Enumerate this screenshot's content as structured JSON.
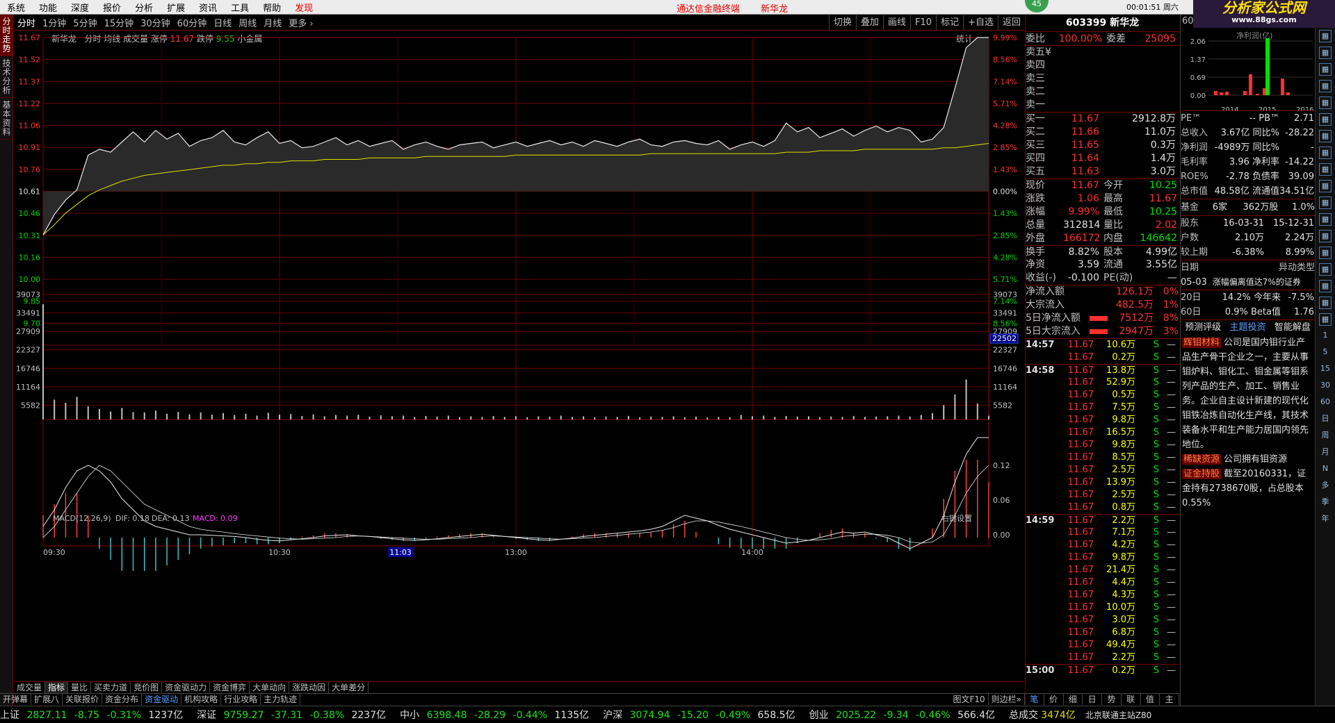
{
  "menu": {
    "items": [
      "系统",
      "功能",
      "深度",
      "报价",
      "分析",
      "扩展",
      "资讯",
      "工具",
      "帮助",
      "发现"
    ],
    "center": [
      "通达信金融终端",
      "新华龙"
    ],
    "time": "00:01:51 周六",
    "badge": "45"
  },
  "logo": {
    "title": "分析家公式网",
    "url": "www.88gs.com"
  },
  "left_tabs": [
    "分时走势",
    "技术分析",
    "基本资料"
  ],
  "periods": [
    "分时",
    "1分钟",
    "5分钟",
    "15分钟",
    "30分钟",
    "60分钟",
    "日线",
    "周线",
    "月线",
    "更多 ›"
  ],
  "chart_tools": [
    "切换",
    "叠加",
    "画线",
    "F10",
    "标记",
    "+自选",
    "返回"
  ],
  "chart_header": {
    "name": "新华龙",
    "items": "分时 均线 成交量 涨停",
    "zt": "11.67",
    "dt_label": "跌停",
    "dt": "9.55",
    "block": "小金属",
    "stat": "统计"
  },
  "price_axis": {
    "left": [
      "11.67",
      "11.52",
      "11.37",
      "11.22",
      "11.06",
      "10.91",
      "10.76",
      "10.61",
      "10.46",
      "10.31",
      "10.16",
      "10.00",
      "9.85",
      "9.70"
    ],
    "right": [
      "9.99%",
      "8.56%",
      "7.14%",
      "5.71%",
      "4.28%",
      "2.85%",
      "1.43%",
      "0.00%",
      "1.43%",
      "2.85%",
      "4.28%",
      "5.71%",
      "7.14%",
      "8.56%"
    ]
  },
  "vol_axis": [
    "39073",
    "33491",
    "27909",
    "22327",
    "16746",
    "11164",
    "5582"
  ],
  "vol_cursor": "22502",
  "macd": {
    "title": "MACD(12,26,9)",
    "dif": "DIF: 0.18",
    "dea": "DEA: 0.13",
    "macd": "MACD: 0.09",
    "setting": "右键设置",
    "axis": [
      "0.12",
      "0.06",
      "0.00"
    ]
  },
  "time_axis": [
    "09:30",
    "10:30",
    "11:03",
    "13:00",
    "14:00"
  ],
  "bottom_tabs": [
    "成交量",
    "指标",
    "量比",
    "买卖力道",
    "竞价图",
    "资金驱动力",
    "资金博弈",
    "大单动向",
    "涨跌动因",
    "大单差分"
  ],
  "bottom_tabs2": [
    "开弹幕",
    "扩展八",
    "关联报价",
    "资金分布",
    "资金驱动",
    "机构攻略",
    "行业攻略",
    "主力轨迹"
  ],
  "bottom_tabs2_right": [
    "图文F10",
    "则边栏»"
  ],
  "quote": {
    "title": "603399 新华龙",
    "wb": [
      "委比",
      "100.00%",
      "委差",
      "25095"
    ],
    "sells": [
      "卖五",
      "卖四",
      "卖三",
      "卖二",
      "卖一"
    ],
    "sell_mark": "¥",
    "buys": [
      [
        "买一",
        "11.67",
        "2912.8万"
      ],
      [
        "买二",
        "11.66",
        "11.0万"
      ],
      [
        "买三",
        "11.65",
        "0.3万"
      ],
      [
        "买四",
        "11.64",
        "1.4万"
      ],
      [
        "买五",
        "11.63",
        "3.0万"
      ]
    ],
    "info": [
      [
        "现价",
        "11.67",
        "今开",
        "10.25"
      ],
      [
        "涨跌",
        "1.06",
        "最高",
        "11.67"
      ],
      [
        "涨幅",
        "9.99%",
        "最低",
        "10.25"
      ],
      [
        "总量",
        "312814",
        "量比",
        "2.02"
      ],
      [
        "外盘",
        "166172",
        "内盘",
        "146642"
      ],
      [
        "换手",
        "8.82%",
        "股本",
        "4.99亿"
      ],
      [
        "净资",
        "3.59",
        "流通",
        "3.55亿"
      ],
      [
        "收益(-)",
        "-0.100",
        "PE(动)",
        "—"
      ]
    ],
    "flows": [
      [
        "净流入额",
        "126.1万",
        "0%"
      ],
      [
        "大宗流入",
        "482.5万",
        "1%"
      ],
      [
        "5日净流入额",
        "7512万",
        "8%"
      ],
      [
        "5日大宗流入",
        "2947万",
        "3%"
      ]
    ]
  },
  "ticks": [
    [
      "14:57",
      "11.67",
      "10.6万",
      "S",
      "—"
    ],
    [
      "",
      "11.67",
      "0.2万",
      "S",
      "—"
    ],
    [
      "14:58",
      "11.67",
      "13.8万",
      "S",
      "—"
    ],
    [
      "",
      "11.67",
      "52.9万",
      "S",
      "—"
    ],
    [
      "",
      "11.67",
      "0.5万",
      "S",
      "—"
    ],
    [
      "",
      "11.67",
      "7.5万",
      "S",
      "—"
    ],
    [
      "",
      "11.67",
      "9.8万",
      "S",
      "—"
    ],
    [
      "",
      "11.67",
      "16.5万",
      "S",
      "—"
    ],
    [
      "",
      "11.67",
      "9.8万",
      "S",
      "—"
    ],
    [
      "",
      "11.67",
      "8.5万",
      "S",
      "—"
    ],
    [
      "",
      "11.67",
      "2.5万",
      "S",
      "—"
    ],
    [
      "",
      "11.67",
      "13.9万",
      "S",
      "—"
    ],
    [
      "",
      "11.67",
      "2.5万",
      "S",
      "—"
    ],
    [
      "",
      "11.67",
      "0.8万",
      "S",
      "—"
    ],
    [
      "14:59",
      "11.67",
      "2.2万",
      "S",
      "—"
    ],
    [
      "",
      "11.67",
      "7.1万",
      "S",
      "—"
    ],
    [
      "",
      "11.67",
      "4.2万",
      "S",
      "—"
    ],
    [
      "",
      "11.67",
      "9.8万",
      "S",
      "—"
    ],
    [
      "",
      "11.67",
      "21.4万",
      "S",
      "—"
    ],
    [
      "",
      "11.67",
      "4.4万",
      "S",
      "—"
    ],
    [
      "",
      "11.67",
      "4.3万",
      "S",
      "—"
    ],
    [
      "",
      "11.67",
      "10.0万",
      "S",
      "—"
    ],
    [
      "",
      "11.67",
      "3.0万",
      "S",
      "—"
    ],
    [
      "",
      "11.67",
      "6.8万",
      "S",
      "—"
    ],
    [
      "",
      "11.67",
      "49.4万",
      "S",
      "—"
    ],
    [
      "",
      "11.67",
      "2.2万",
      "S",
      "—"
    ],
    [
      "15:00",
      "11.67",
      "0.2万",
      "S",
      "—"
    ]
  ],
  "bottom_right": [
    "笔",
    "价",
    "细",
    "日",
    "势",
    "联",
    "值",
    "主"
  ],
  "fundamentals": {
    "head": "60",
    "bar_axis": [
      "2.06",
      "1.37",
      "0.69",
      "0.00"
    ],
    "bar_years": [
      "2014",
      "2015",
      "2016"
    ],
    "bar_caption": "净利润(亿)",
    "rows": [
      [
        "PE™",
        "-- PB™",
        "2.71"
      ],
      [
        "总收入",
        "3.67亿 同比%",
        "-28.22"
      ],
      [
        "净利润",
        "-4989万 同比%",
        "-"
      ],
      [
        "毛利率",
        "3.96 净利率",
        "-14.22"
      ],
      [
        "ROE%",
        "-2.78 负债率",
        "39.09"
      ],
      [
        "总市值",
        "48.58亿 流通值",
        "34.51亿"
      ]
    ],
    "fund": [
      "基金",
      "6家",
      "362万股",
      "1.0%"
    ],
    "holders": [
      [
        "股东",
        "16-03-31",
        "15-12-31"
      ],
      [
        "户数",
        "2.10万",
        "2.24万"
      ],
      [
        "较上期",
        "-6.38%",
        "8.99%"
      ]
    ],
    "event_head": [
      "日期",
      "异动类型"
    ],
    "event": [
      "05-03",
      "涨幅偏离值达7%的证券"
    ],
    "perf": [
      [
        "20日",
        "14.2% 今年来",
        "-7.5%"
      ],
      [
        "60日",
        "0.9% Beta值",
        "1.76"
      ]
    ],
    "tabs": [
      "预测评级",
      "主题投资",
      "智能解盘"
    ],
    "themes": [
      {
        "tag": "辉钼材料",
        "text": "公司是国内钼行业产品生产骨干企业之一，主要从事钼炉料、钼化工、钼金属等钼系列产品的生产、加工、销售业务。企业自主设计新建的现代化钼铁冶炼自动化生产线，其技术装备水平和生产能力居国内领先地位。"
      },
      {
        "tag": "稀缺资源",
        "text": "公司拥有钼资源"
      },
      {
        "tag": "证金持股",
        "text": "截至20160331，证金持有2738670股，占总股本0.55%"
      }
    ]
  },
  "icon_bar": [
    "1",
    "5",
    "15",
    "30",
    "60",
    "日",
    "周",
    "月",
    "N",
    "多",
    "季",
    "年"
  ],
  "status": [
    {
      "name": "上证",
      "price": "2827.11",
      "chg": "-8.75",
      "pct": "-0.31%",
      "amt": "1237亿"
    },
    {
      "name": "深证",
      "price": "9759.27",
      "chg": "-37.31",
      "pct": "-0.38%",
      "amt": "2237亿"
    },
    {
      "name": "中小",
      "price": "6398.48",
      "chg": "-28.29",
      "pct": "-0.44%",
      "amt": "1135亿"
    },
    {
      "name": "沪深",
      "price": "3074.94",
      "chg": "-15.20",
      "pct": "-0.49%",
      "amt": "658.5亿"
    },
    {
      "name": "创业",
      "price": "2025.22",
      "chg": "-9.34",
      "pct": "-0.46%",
      "amt": "566.4亿"
    }
  ],
  "status_total": {
    "label": "总成交",
    "value": "3474亿",
    "server": "北京联通主站Z80"
  },
  "chart_data": {
    "type": "line",
    "title": "新华龙 分时",
    "prev_close": 10.61,
    "ylim": [
      9.55,
      11.67
    ],
    "price_series": [
      10.31,
      10.45,
      10.55,
      10.62,
      10.86,
      10.9,
      10.88,
      10.95,
      11.02,
      10.95,
      11.03,
      10.97,
      11.01,
      10.92,
      10.96,
      10.98,
      11.03,
      10.95,
      10.93,
      10.98,
      11.02,
      10.94,
      10.96,
      10.91,
      10.92,
      10.95,
      10.98,
      10.93,
      10.96,
      10.92,
      10.94,
      10.96,
      10.9,
      10.93,
      10.95,
      10.92,
      10.9,
      10.93,
      10.94,
      10.95,
      10.91,
      10.93,
      10.95,
      10.92,
      10.94,
      10.96,
      10.93,
      10.95,
      10.92,
      10.96,
      10.94,
      10.92,
      10.95,
      10.97,
      10.93,
      10.92,
      10.95,
      10.96,
      10.94,
      10.93,
      10.96,
      10.9,
      10.93,
      10.95,
      10.92,
      10.96,
      11.08,
      11.02,
      11.05,
      10.98,
      11.01,
      11.04,
      10.99,
      11.03,
      11.06,
      11.02,
      11.05,
      11.03,
      10.95,
      10.97,
      11.05,
      11.32,
      11.6,
      11.67,
      11.67
    ],
    "avg_series": [
      10.31,
      10.38,
      10.46,
      10.52,
      10.58,
      10.62,
      10.65,
      10.68,
      10.7,
      10.72,
      10.73,
      10.74,
      10.75,
      10.76,
      10.77,
      10.78,
      10.79,
      10.79,
      10.8,
      10.8,
      10.81,
      10.81,
      10.82,
      10.82,
      10.82,
      10.83,
      10.83,
      10.83,
      10.83,
      10.84,
      10.84,
      10.84,
      10.84,
      10.84,
      10.85,
      10.85,
      10.85,
      10.85,
      10.85,
      10.85,
      10.85,
      10.85,
      10.86,
      10.86,
      10.86,
      10.86,
      10.86,
      10.86,
      10.86,
      10.86,
      10.86,
      10.86,
      10.86,
      10.86,
      10.87,
      10.87,
      10.87,
      10.87,
      10.87,
      10.87,
      10.87,
      10.87,
      10.87,
      10.87,
      10.87,
      10.87,
      10.88,
      10.88,
      10.88,
      10.89,
      10.89,
      10.89,
      10.89,
      10.9,
      10.9,
      10.9,
      10.9,
      10.9,
      10.9,
      10.9,
      10.91,
      10.91,
      10.92,
      10.93,
      10.94
    ],
    "volume_series": [
      36000,
      6200,
      5200,
      7100,
      4100,
      3300,
      2500,
      3600,
      2300,
      2200,
      2800,
      1800,
      2400,
      1600,
      2200,
      1500,
      2000,
      1400,
      1800,
      1200,
      2100,
      1500,
      1700,
      1100,
      1600,
      1000,
      1400,
      1200,
      1500,
      900,
      1300,
      1000,
      1200,
      800,
      1100,
      900,
      1200,
      700,
      1000,
      800,
      1100,
      800,
      1000,
      700,
      1000,
      900,
      1200,
      800,
      1000,
      700,
      900,
      800,
      1100,
      700,
      900,
      800,
      1000,
      700,
      900,
      600,
      800,
      700,
      1400,
      1000,
      1200,
      800,
      1100,
      900,
      1000,
      700,
      900,
      800,
      1100,
      800,
      900,
      1000,
      1200,
      900,
      1400,
      2000,
      4500,
      7800,
      12500,
      5000,
      1200
    ],
    "macd_dif": [
      0.02,
      0.05,
      0.09,
      0.12,
      0.13,
      0.12,
      0.1,
      0.07,
      0.05,
      0.03,
      0.02,
      0.015,
      0.01,
      0.005,
      0.005,
      0.004,
      0.003,
      0.002,
      0.0,
      -0.003,
      -0.005,
      -0.006,
      -0.004,
      -0.002,
      0.0,
      0.003,
      0.004,
      0.005,
      0.003,
      0.002,
      0.0,
      -0.002,
      -0.004,
      -0.005,
      -0.004,
      -0.002,
      0.0,
      0.002,
      0.004,
      0.006,
      0.004,
      0.002,
      0.0,
      -0.002,
      -0.004,
      -0.005,
      -0.003,
      -0.001,
      0.002,
      0.004,
      0.006,
      0.008,
      0.01,
      0.012,
      0.015,
      0.02,
      0.03,
      0.04,
      0.035,
      0.03,
      0.022,
      0.015,
      0.01,
      0.005,
      0.0,
      -0.005,
      -0.01,
      -0.008,
      -0.005,
      0.0,
      0.005,
      0.01,
      0.008,
      0.01,
      0.005,
      0.0,
      -0.01,
      -0.02,
      -0.01,
      0.0,
      0.04,
      0.1,
      0.15,
      0.18,
      0.18
    ],
    "macd_dea": [
      0.0,
      0.02,
      0.05,
      0.08,
      0.11,
      0.13,
      0.12,
      0.1,
      0.08,
      0.06,
      0.05,
      0.04,
      0.03,
      0.02,
      0.015,
      0.012,
      0.01,
      0.007,
      0.005,
      0.003,
      0.001,
      -0.001,
      -0.002,
      -0.003,
      -0.002,
      -0.001,
      0.0,
      0.002,
      0.003,
      0.002,
      0.001,
      0.0,
      -0.001,
      -0.002,
      -0.003,
      -0.003,
      -0.002,
      -0.001,
      0.0,
      0.002,
      0.003,
      0.002,
      0.001,
      0.0,
      -0.001,
      -0.002,
      -0.003,
      -0.002,
      -0.001,
      0.0,
      0.002,
      0.004,
      0.006,
      0.008,
      0.01,
      0.013,
      0.018,
      0.025,
      0.03,
      0.03,
      0.028,
      0.024,
      0.02,
      0.015,
      0.01,
      0.005,
      0.0,
      -0.003,
      -0.005,
      -0.004,
      -0.002,
      0.002,
      0.004,
      0.006,
      0.006,
      0.004,
      0.0,
      -0.008,
      -0.01,
      -0.008,
      0.005,
      0.04,
      0.08,
      0.11,
      0.13
    ]
  }
}
